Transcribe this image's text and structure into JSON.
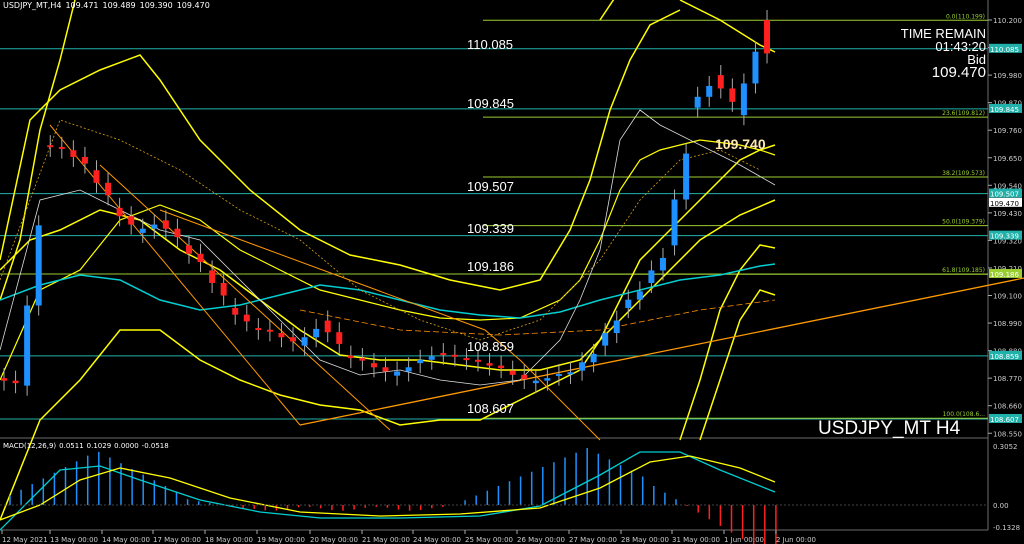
{
  "header": {
    "symbol_tf": "USDJPY_MT,H4",
    "open": "109.471",
    "high": "109.489",
    "low": "109.390",
    "close": "109.470"
  },
  "info": {
    "time_remain_label": "TIME REMAIN",
    "time_remain_value": "01:43:20",
    "bid_label": "Bid",
    "bid_value": "109.470",
    "current_big": "109.740",
    "symbol_watermark": "USDJPY_MT H4"
  },
  "levels": {
    "l1": "110.085",
    "l2": "109.845",
    "l3": "109.507",
    "l4": "109.339",
    "l5": "109.186",
    "l6": "108.859",
    "l7": "108.607"
  },
  "price_axis": {
    "ticks": [
      "110.200",
      "110.090",
      "109.980",
      "109.870",
      "109.760",
      "109.650",
      "109.540",
      "109.430",
      "109.320",
      "109.210",
      "109.100",
      "108.990",
      "108.880",
      "108.770",
      "108.660",
      "108.550"
    ],
    "tags": [
      {
        "text": "110.085",
        "color": "#20b2aa"
      },
      {
        "text": "109.845",
        "color": "#20b2aa"
      },
      {
        "text": "109.507",
        "color": "#20b2aa"
      },
      {
        "text": "109.470",
        "color": "#ffffff"
      },
      {
        "text": "109.339",
        "color": "#20b2aa"
      },
      {
        "text": "109.186",
        "color": "#9acd32"
      },
      {
        "text": "108.859",
        "color": "#20b2aa"
      },
      {
        "text": "108.607",
        "color": "#20b2aa"
      }
    ]
  },
  "fibo": [
    {
      "label": "0.0(110.199)"
    },
    {
      "label": "23.6(109.812)"
    },
    {
      "label": "38.2(109.573)"
    },
    {
      "label": "50.0(109.379)"
    },
    {
      "label": "61.8(109.185)"
    },
    {
      "label": "100.0(108.6..."
    }
  ],
  "macd": {
    "name": "MACD(12,26,9)",
    "v1": "0.0511",
    "v2": "0.1029",
    "v3": "0.0000",
    "v4": "-0.0518",
    "ticks": [
      "0.3052",
      "0.00",
      "-0.1328"
    ]
  },
  "time_axis": [
    "12 May 2021",
    "13 May 00:00",
    "14 May 00:00",
    "17 May 00:00",
    "18 May 00:00",
    "19 May 00:00",
    "20 May 00:00",
    "21 May 00:00",
    "24 May 00:00",
    "25 May 00:00",
    "26 May 00:00",
    "27 May 00:00",
    "28 May 00:00",
    "31 May 00:00",
    "1 Jun 00:00",
    "2 Jun 00:00"
  ],
  "colors": {
    "bull": "#1e90ff",
    "bear": "#ff2020",
    "band": "#ffff00",
    "ema": "#00ced1",
    "trend": "#ff9900",
    "level": "#20b2aa",
    "fibo": "#9acd32"
  },
  "chart_data": {
    "type": "candlestick",
    "timeframe": "H4",
    "close_path": [
      108.77,
      108.74,
      109.7,
      109.68,
      109.6,
      109.45,
      109.35,
      109.4,
      109.3,
      109.2,
      109.05,
      108.97,
      108.95,
      108.9,
      109.0,
      108.86,
      108.83,
      108.78,
      108.83,
      108.87,
      108.85,
      108.83,
      108.8,
      108.75,
      108.78,
      108.8,
      108.9,
      109.05,
      109.15,
      109.3,
      109.85,
      109.98,
      109.82,
      110.2,
      109.8,
      109.7,
      109.6,
      109.55,
      109.5,
      109.6,
      109.47
    ]
  }
}
